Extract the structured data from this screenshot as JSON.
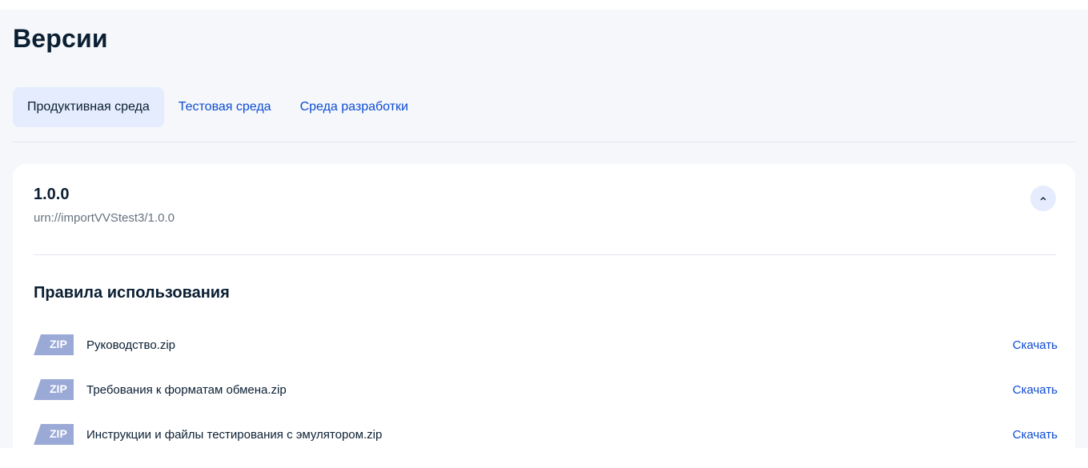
{
  "page": {
    "title": "Версии"
  },
  "tabs": [
    {
      "label": "Продуктивная среда",
      "active": true
    },
    {
      "label": "Тестовая среда",
      "active": false
    },
    {
      "label": "Среда разработки",
      "active": false
    }
  ],
  "version": {
    "number": "1.0.0",
    "urn": "urn://importVVStest3/1.0.0",
    "collapse_icon": "chevron-up-icon"
  },
  "usage_rules": {
    "title": "Правила использования",
    "files": [
      {
        "badge": "ZIP",
        "name": "Руководство.zip",
        "action": "Скачать"
      },
      {
        "badge": "ZIP",
        "name": "Требования к форматам обмена.zip",
        "action": "Скачать"
      },
      {
        "badge": "ZIP",
        "name": "Инструкции и файлы тестирования с эмулятором.zip",
        "action": "Скачать"
      }
    ]
  },
  "colors": {
    "accent": "#0d4cd3",
    "tab_active_bg": "#e4ecfd",
    "zip_badge": "#9aa9d6",
    "page_bg": "#f5f7fa"
  }
}
